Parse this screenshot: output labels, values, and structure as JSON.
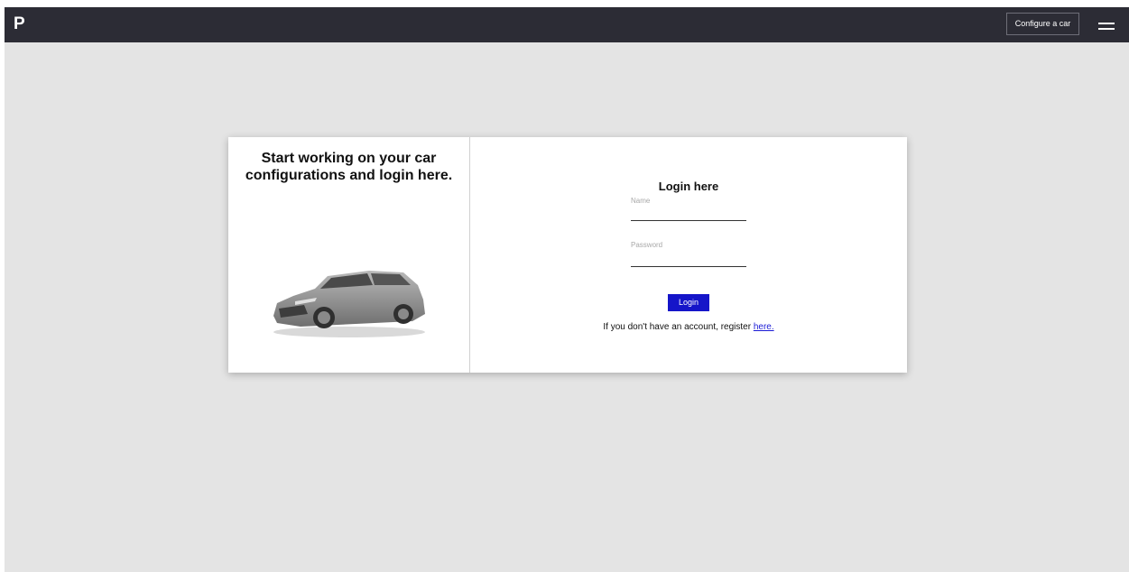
{
  "navbar": {
    "brand": "P",
    "configure_label": "Configure a car",
    "menu_icon": "hamburger-menu-icon",
    "background": "#2c2c35"
  },
  "hero": {
    "tagline": "Start working on your car configurations and login here.",
    "image": "car-image"
  },
  "login": {
    "title": "Login here",
    "name_label": "Name",
    "name_value": "",
    "password_label": "Password",
    "password_value": "",
    "submit_label": "Login",
    "register_prefix": "If you don't have an account, register ",
    "register_link": "here.",
    "accent_color": "#1515c9"
  },
  "page": {
    "background": "#e4e4e4"
  }
}
